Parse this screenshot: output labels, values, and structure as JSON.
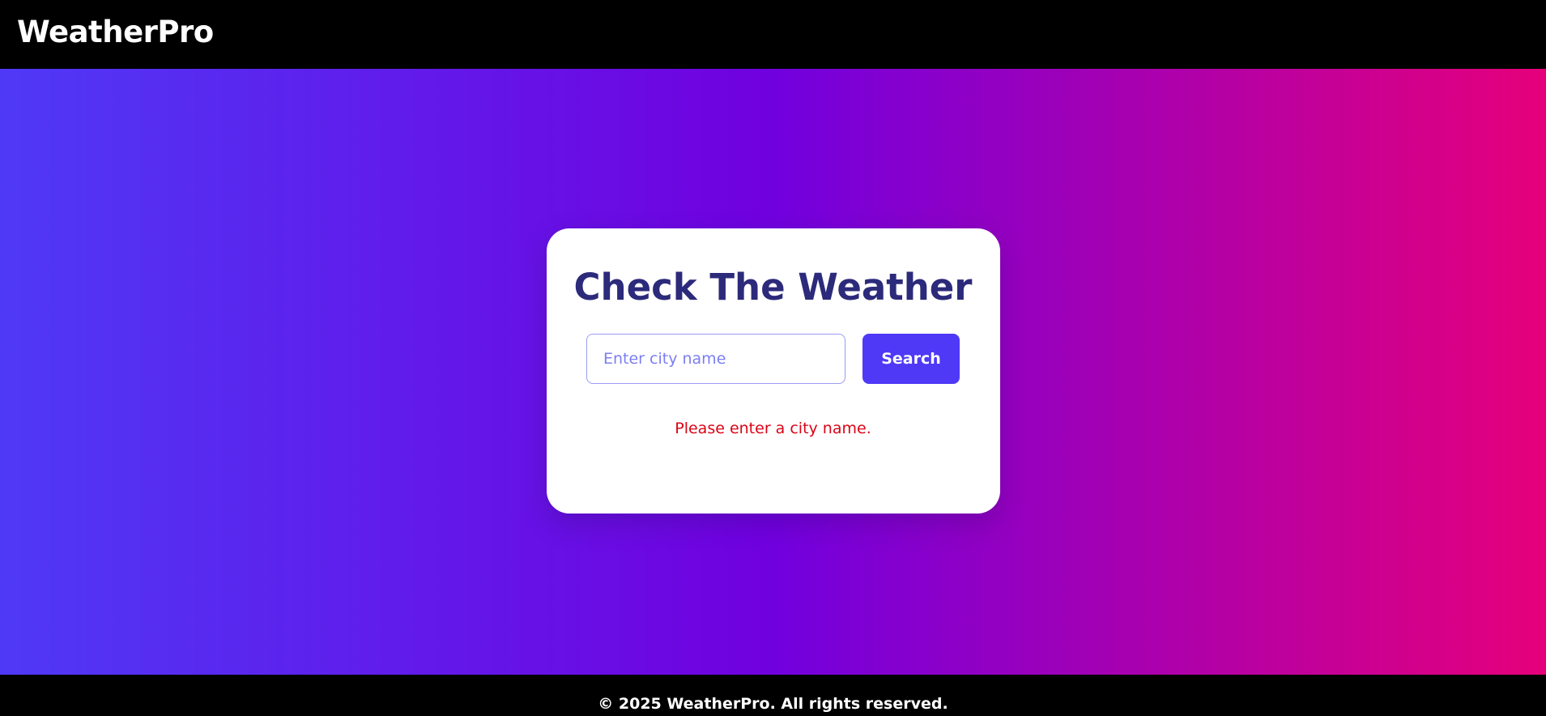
{
  "header": {
    "brand": "WeatherPro"
  },
  "card": {
    "title": "Check The Weather",
    "search": {
      "placeholder": "Enter city name",
      "value": "",
      "button_label": "Search"
    },
    "error_message": "Please enter a city name."
  },
  "footer": {
    "copyright": "© 2025 WeatherPro. All rights reserved."
  },
  "colors": {
    "header_bg": "#000000",
    "gradient_start": "#4f39f6",
    "gradient_mid": "#7100df",
    "gradient_end": "#e6007a",
    "title": "#2c2a7a",
    "button_bg": "#4f39f6",
    "error": "#d90416"
  }
}
